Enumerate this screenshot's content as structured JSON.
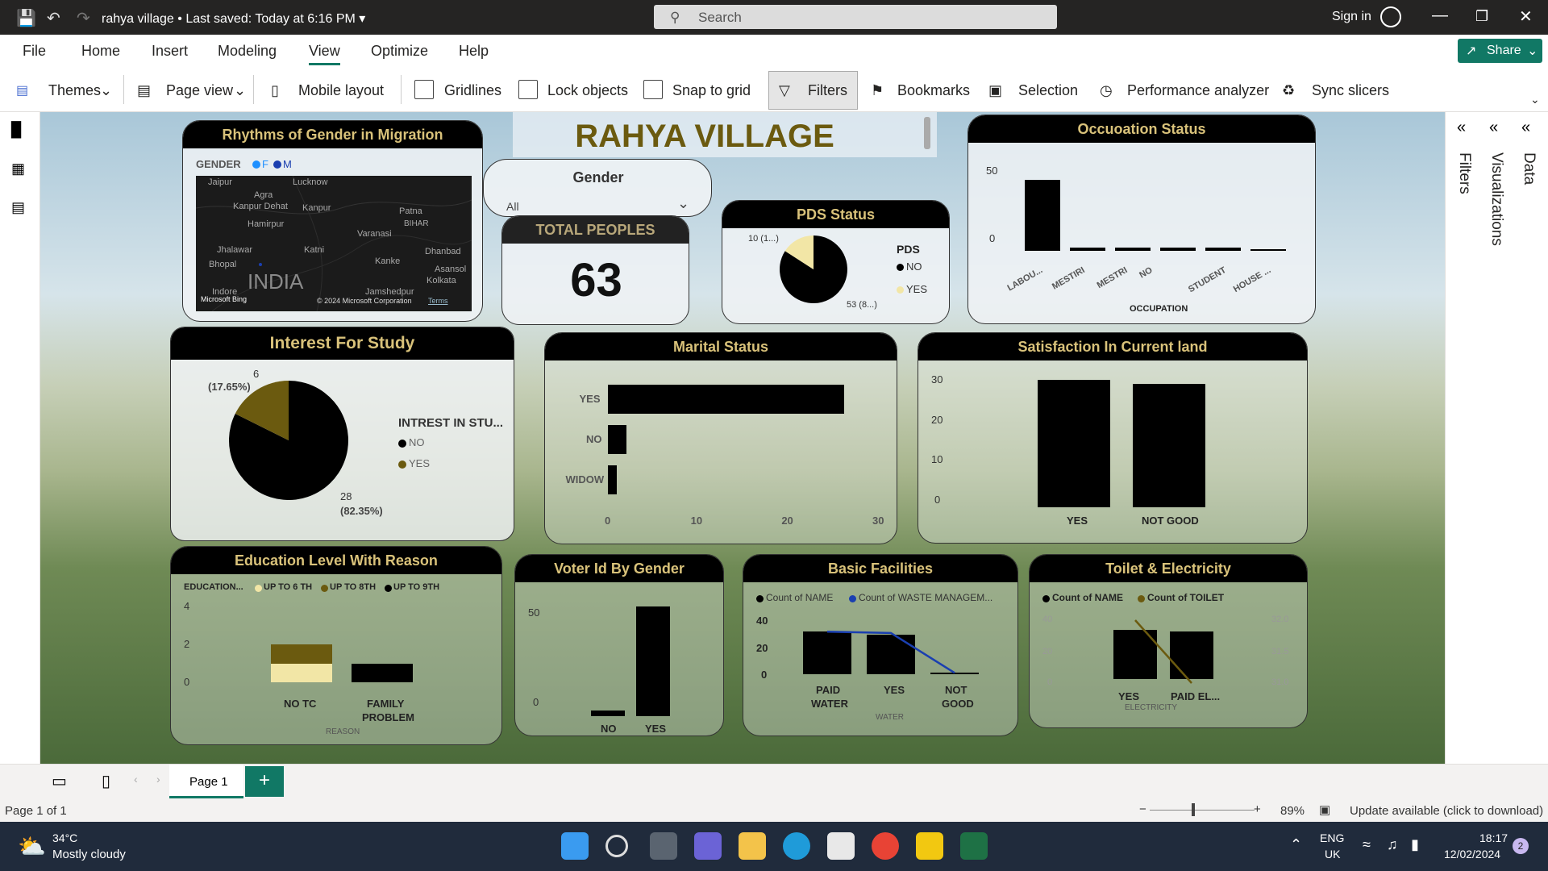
{
  "titlebar": {
    "file_title": "rahya village",
    "saved_status": "Last saved: Today at 6:16 PM",
    "search_placeholder": "Search",
    "signin": "Sign in"
  },
  "menu": [
    "File",
    "Home",
    "Insert",
    "Modeling",
    "View",
    "Optimize",
    "Help"
  ],
  "share_label": "Share",
  "ribbon": {
    "themes": "Themes",
    "page_view": "Page view",
    "mobile_layout": "Mobile layout",
    "gridlines": "Gridlines",
    "lock_objects": "Lock objects",
    "snap_to_grid": "Snap to grid",
    "filters": "Filters",
    "bookmarks": "Bookmarks",
    "selection": "Selection",
    "performance_analyzer": "Performance analyzer",
    "sync_slicers": "Sync slicers"
  },
  "panels": {
    "filters": "Filters",
    "visualizations": "Visualizations",
    "data": "Data"
  },
  "report": {
    "title": "RAHYA VILLAGE",
    "map_card": {
      "title": "Rhythms of Gender in Migration",
      "legend_title": "GENDER",
      "legend_f": "F",
      "legend_m": "M",
      "places": [
        "Jaipur",
        "Lucknow",
        "Agra",
        "Kanpur Dehat",
        "Kanpur",
        "Hamirpur",
        "Patna",
        "BIHAR",
        "Varanasi",
        "Jhalawar",
        "Bhopal",
        "Katni",
        "Dhanbad",
        "Kanke",
        "Asansol",
        "Kolkata",
        "Indore",
        "Jamshedpur",
        "INDIA"
      ],
      "attribution": "© 2024 Microsoft Corporation",
      "terms": "Terms",
      "bing": "Microsoft Bing"
    },
    "gender_slicer": {
      "title": "Gender",
      "value": "All"
    },
    "total_card": {
      "title": "TOTAL PEOPLES",
      "value": "63"
    },
    "pds_card": {
      "title": "PDS Status",
      "legend_title": "PDS",
      "legend_no": "NO",
      "legend_yes": "YES",
      "label_small": "10 (1...)",
      "label_large": "53 (8...)"
    },
    "occupation_card": {
      "title": "Occuoation Status",
      "xlabel": "OCCUPATION",
      "y_ticks": [
        "50",
        "0"
      ]
    },
    "study_card": {
      "title": "Interest For Study",
      "legend_title": "INTREST IN STU...",
      "legend_no": "NO",
      "legend_yes": "YES",
      "label_yes_1": "6",
      "label_yes_2": "(17.65%)",
      "label_no_1": "28",
      "label_no_2": "(82.35%)"
    },
    "marital_card": {
      "title": "Marital Status",
      "x_ticks": [
        "0",
        "10",
        "20",
        "30"
      ]
    },
    "satisfaction_card": {
      "title": "Satisfaction In Current land",
      "y_ticks": [
        "30",
        "20",
        "10",
        "0"
      ]
    },
    "education_card": {
      "title": "Education Level With Reason",
      "legend_title": "EDUCATION...",
      "legend_items": [
        "UP TO 6 TH",
        "UP TO 8TH",
        "UP TO 9TH"
      ],
      "y_ticks": [
        "4",
        "2",
        "0"
      ],
      "cat1": "NO TC",
      "cat2_line1": "FAMILY",
      "cat2_line2": "PROBLEM",
      "xlabel": "REASON"
    },
    "voter_card": {
      "title": "Voter Id By Gender",
      "y_ticks": [
        "50",
        "0"
      ]
    },
    "facilities_card": {
      "title": "Basic Facilities",
      "legend_1": "Count of NAME",
      "legend_2": "Count of WASTE MANAGEM...",
      "y_ticks": [
        "40",
        "20",
        "0"
      ],
      "cat1_l1": "PAID",
      "cat1_l2": "WATER",
      "cat2": "YES",
      "cat3_l1": "NOT",
      "cat3_l2": "GOOD",
      "xlabel": "WATER"
    },
    "toilet_card": {
      "title": "Toilet & Electricity",
      "legend_1": "Count of NAME",
      "legend_2": "Count of TOILET",
      "y_ticks": [
        "40",
        "20",
        "0"
      ],
      "y2_ticks": [
        "32.0",
        "31.5",
        "31.0"
      ],
      "cat1": "YES",
      "cat2": "PAID EL...",
      "xlabel": "ELECTRICITY"
    }
  },
  "chart_data": [
    {
      "type": "pie",
      "title": "PDS Status",
      "categories": [
        "NO",
        "YES"
      ],
      "values": [
        53,
        10
      ]
    },
    {
      "type": "bar",
      "title": "Occuoation Status",
      "xlabel": "OCCUPATION",
      "categories": [
        "LABOU...",
        "MESTIRI",
        "MESTRI",
        "NO",
        "STUDENT",
        "HOUSE ..."
      ],
      "values": [
        49,
        2,
        2,
        2,
        2,
        1
      ],
      "ylim": [
        0,
        60
      ]
    },
    {
      "type": "pie",
      "title": "Interest For Study",
      "categories": [
        "NO",
        "YES"
      ],
      "values": [
        28,
        6
      ]
    },
    {
      "type": "bar",
      "title": "Marital Status",
      "orientation": "horizontal",
      "categories": [
        "YES",
        "NO",
        "WIDOW"
      ],
      "values": [
        26,
        2,
        1
      ],
      "xlim": [
        0,
        30
      ]
    },
    {
      "type": "bar",
      "title": "Satisfaction In Current land",
      "categories": [
        "YES",
        "NOT GOOD"
      ],
      "values": [
        32,
        31
      ],
      "ylim": [
        0,
        35
      ]
    },
    {
      "type": "bar",
      "title": "Education Level With Reason",
      "stacked": true,
      "xlabel": "REASON",
      "categories": [
        "NO TC",
        "FAMILY PROBLEM"
      ],
      "series": [
        {
          "name": "UP TO 6 TH",
          "values": [
            1,
            0
          ]
        },
        {
          "name": "UP TO 8TH",
          "values": [
            1,
            0
          ]
        },
        {
          "name": "UP TO 9TH",
          "values": [
            0,
            1
          ]
        }
      ],
      "ylim": [
        0,
        4
      ]
    },
    {
      "type": "bar",
      "title": "Voter Id By Gender",
      "categories": [
        "NO",
        "YES"
      ],
      "values": [
        3,
        60
      ],
      "ylim": [
        0,
        60
      ]
    },
    {
      "type": "bar",
      "title": "Basic Facilities",
      "xlabel": "WATER",
      "categories": [
        "PAID WATER",
        "YES",
        "NOT GOOD"
      ],
      "series": [
        {
          "name": "Count of NAME",
          "values": [
            32,
            30,
            1
          ]
        },
        {
          "name": "Count of WASTE MANAGEM...",
          "values": [
            32,
            31,
            1
          ]
        }
      ],
      "ylim": [
        0,
        40
      ]
    },
    {
      "type": "bar",
      "title": "Toilet & Electricity",
      "xlabel": "ELECTRICITY",
      "categories": [
        "YES",
        "PAID EL..."
      ],
      "series": [
        {
          "name": "Count of NAME",
          "values": [
            32,
            31
          ]
        },
        {
          "name": "Count of TOILET",
          "values": [
            32,
            31
          ]
        }
      ],
      "ylim": [
        0,
        40
      ],
      "y2lim": [
        31.0,
        32.0
      ]
    }
  ],
  "pagetabs": {
    "page1": "Page 1"
  },
  "statusbar": {
    "page_info": "Page 1 of 1",
    "zoom": "89%",
    "update": "Update available (click to download)"
  },
  "taskbar": {
    "temp": "34°C",
    "weather": "Mostly cloudy",
    "lang1": "ENG",
    "lang2": "UK",
    "time": "18:17",
    "date": "12/02/2024",
    "notif": "2"
  },
  "colors": {
    "brand": "#117865",
    "dark_gold": "#6b5a0f",
    "light_gold": "#f2e6a6",
    "title_gold": "#d9c27a"
  }
}
